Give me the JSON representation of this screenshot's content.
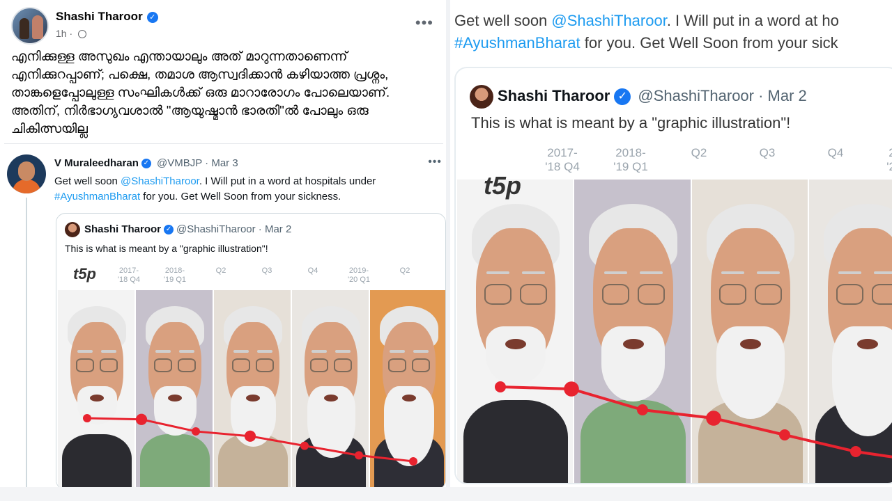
{
  "fb_post": {
    "author": "Shashi Tharoor",
    "time": "1h",
    "more": "•••",
    "text": "എനിക്കുള്ള അസുഖം എന്തായാലും അത് മാറുന്നതാണെന്ന് എനിക്കുറപ്പാണ്; പക്ഷെ, തമാശ ആസ്വദിക്കാൻ കഴിയാത്ത പ്രശ്നം, താങ്കളെപ്പോലുള്ള സംഘികൾക്ക് ഒരു മാറാരോഗം പോലെയാണ്. അതിന്, നിർഭാഗ്യവശാൽ \"ആയുഷ്മാൻ ഭാരതി\"ൽ പോലും ഒരു ചികിത്സയില്ല"
  },
  "tweet": {
    "name": "V Muraleedharan",
    "handle_date": "@VMBJP · Mar 3",
    "more": "•••",
    "text_pre": "Get well soon ",
    "mention": "@ShashiTharoor",
    "text_mid": ". I Will put in a word at hospitals under ",
    "hashtag": "#AyushmanBharat",
    "text_post": " for you. Get Well Soon from your sickness."
  },
  "quoted": {
    "name": "Shashi Tharoor",
    "handle_date": "@ShashiTharoor · Mar 2",
    "text": "This is what is meant by a \"graphic illustration\"!"
  },
  "right_panel": {
    "line1_pre": "Get well soon ",
    "line1_mention": "@ShashiTharoor",
    "line1_post": ". I Will put in a word at ho",
    "line2_hashtag": "#AyushmanBharat",
    "line2_post": " for you. Get Well Soon from your sick"
  },
  "chart_data": {
    "type": "line",
    "categories": [
      "2017-\n'18 Q4",
      "2018-\n'19 Q1",
      "Q2",
      "Q3",
      "Q4",
      "2019-\n'20 Q1",
      "Q2"
    ],
    "series": [
      {
        "values": [
          8.1,
          8.0,
          7.0,
          6.6,
          5.8,
          5.0,
          4.5
        ]
      }
    ],
    "line_color": "#e8232f",
    "logo_text": "t5p"
  }
}
